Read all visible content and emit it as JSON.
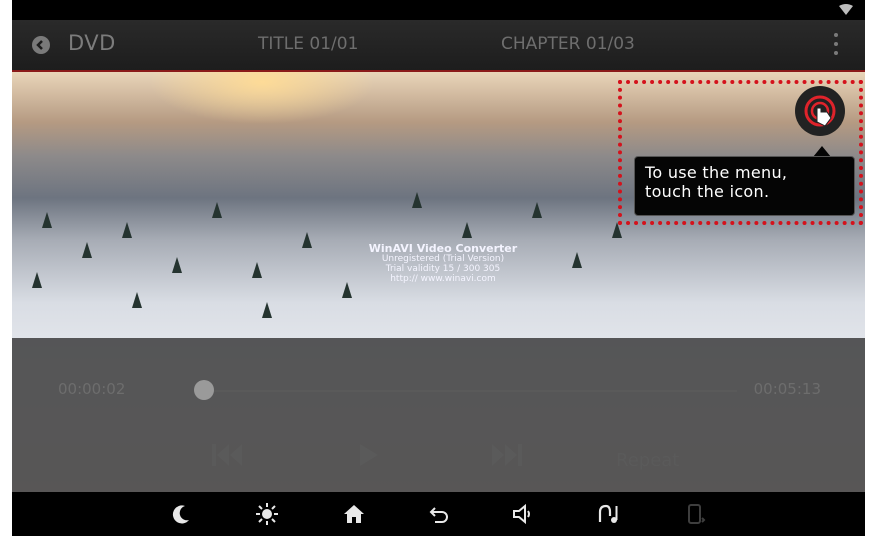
{
  "header": {
    "app_title": "DVD",
    "title_info": "TITLE 01/01",
    "chapter_info": "CHAPTER 01/03"
  },
  "video": {
    "watermark": {
      "line1": "WinAVI Video Converter",
      "line2": "Unregistered (Trial Version)",
      "line3": "Trial validity 15 / 300 305",
      "line4": "http:// www.winavi.com"
    }
  },
  "playback": {
    "current_time": "00:00:02",
    "total_time": "00:05:13",
    "progress": 0.006,
    "repeat_label": "Repeat"
  },
  "tooltip": {
    "line1": "To use the menu,",
    "line2": "touch the icon."
  },
  "icons": {
    "back": "back-circle-icon",
    "menu": "more-vertical-icon",
    "wifi": "wifi-icon",
    "touch": "touch-hand-icon",
    "prev": "skip-previous-icon",
    "play": "play-icon",
    "next": "skip-next-icon",
    "night": "moon-icon",
    "brightness": "sun-icon",
    "home": "home-icon",
    "return": "return-arrow-icon",
    "volume": "speaker-icon",
    "media": "music-note-icon",
    "phone": "phone-connect-icon"
  },
  "colors": {
    "highlight_frame": "#d4121c",
    "accent_line": "#8a1a1a",
    "touch_icon_ring": "#e0232b"
  }
}
